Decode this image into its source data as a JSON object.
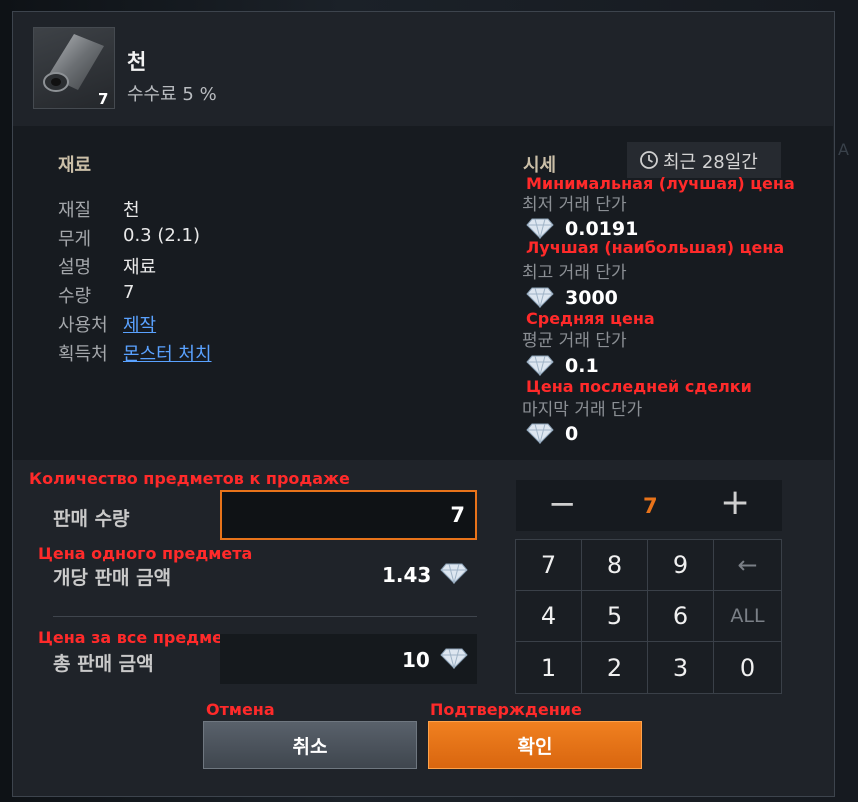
{
  "item": {
    "name": "천",
    "fee": "수수료 5 %",
    "count": "7"
  },
  "material": {
    "heading": "재료",
    "rows": [
      {
        "label": "재질",
        "value": "천"
      },
      {
        "label": "무게",
        "value": "0.3 (2.1)"
      },
      {
        "label": "설명",
        "value": "재료"
      },
      {
        "label": "수량",
        "value": "7"
      },
      {
        "label": "사용처",
        "value": "제작"
      },
      {
        "label": "획득처",
        "value": "몬스터 처치"
      }
    ]
  },
  "market": {
    "heading": "시세",
    "period": "최근 28일간",
    "min_label": "최저 거래 단가",
    "min_value": "0.0191",
    "max_label": "최고 거래 단가",
    "max_value": "3000",
    "avg_label": "평균 거래 단가",
    "avg_value": "0.1",
    "last_label": "마지막 거래 단가",
    "last_value": "0"
  },
  "annotations": {
    "min": "Минимальная (лучшая) цена",
    "max": "Лучшая (наибольшая) цена",
    "avg": "Средняя цена",
    "last": "Цена последней сделки",
    "qty": "Количество предметов к продаже",
    "unit": "Цена одного предмета",
    "total": "Цена за все предметы",
    "cancel": "Отмена",
    "confirm": "Подтверждение"
  },
  "sale": {
    "qty_label": "판매 수량",
    "qty_value": "7",
    "unit_label": "개당 판매 금액",
    "unit_value": "1.43",
    "total_label": "총 판매 금액",
    "total_value": "10"
  },
  "stepper": {
    "minus": "−",
    "value": "7",
    "plus": "+"
  },
  "numpad": {
    "keys": [
      "7",
      "8",
      "9",
      "←",
      "4",
      "5",
      "6",
      "ALL",
      "1",
      "2",
      "3",
      "0"
    ]
  },
  "buttons": {
    "cancel": "취소",
    "confirm": "확인"
  },
  "colors": {
    "accent": "#e8731a",
    "annotation": "#ff2a2a",
    "link": "#5aa2ff"
  }
}
